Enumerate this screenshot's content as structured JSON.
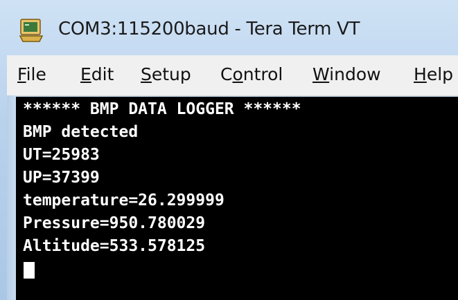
{
  "window": {
    "title": "COM3:115200baud - Tera Term VT",
    "icon": "tera-term-app-icon"
  },
  "menu": {
    "items": [
      {
        "label": "File",
        "mnemonic": "F",
        "rest": "ile"
      },
      {
        "label": "Edit",
        "mnemonic": "E",
        "rest": "dit"
      },
      {
        "label": "Setup",
        "mnemonic": "S",
        "rest": "etup"
      },
      {
        "label": "Control",
        "pre": "C",
        "mnemonic": "o",
        "rest": "ntrol"
      },
      {
        "label": "Window",
        "mnemonic": "W",
        "rest": "indow"
      },
      {
        "label": "Help",
        "mnemonic": "H",
        "rest": "elp"
      }
    ]
  },
  "terminal": {
    "lines": [
      "****** BMP DATA LOGGER ******",
      "BMP detected",
      "UT=25983",
      "UP=37399",
      "temperature=26.299999",
      "Pressure=950.780029",
      "Altitude=533.578125"
    ],
    "background": "#000000",
    "foreground": "#ffffff"
  }
}
